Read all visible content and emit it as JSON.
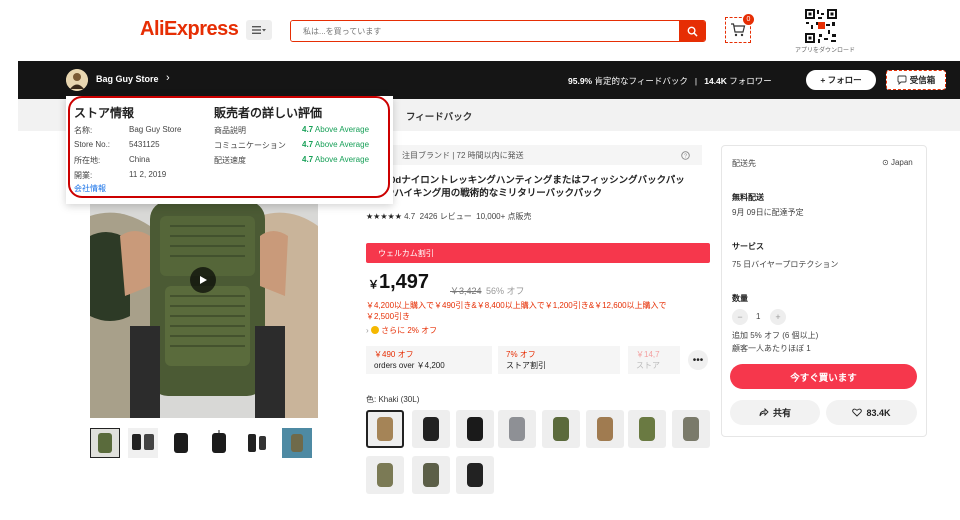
{
  "header": {
    "logo": "AliExpress",
    "menu_icon": "menu-dropdown-icon",
    "search_placeholder": "私は...を買っています",
    "search_icon": "search-icon",
    "cart_count": "0",
    "qr_caption": "アプリをダウンロード"
  },
  "store_bar": {
    "store_name": "Bag Guy Store",
    "feedback_value": "95.9%",
    "feedback_label": "肯定的なフィードバック",
    "separator": "|",
    "followers_value": "14.4K",
    "followers_label": "フォロワー",
    "follow_button": "+ フォロー",
    "message_button": "受信箱"
  },
  "nav": {
    "feedback_tab": "フィードバック"
  },
  "store_popup": {
    "left_title": "ストア情報",
    "right_title": "販売者の詳しい評価",
    "info_rows": [
      {
        "label": "名称:",
        "value": "Bag Guy Store"
      },
      {
        "label": "Store No.:",
        "value": "5431125"
      },
      {
        "label": "所在地:",
        "value": "China"
      },
      {
        "label": "開業:",
        "value": "11 2, 2019"
      }
    ],
    "ratings": [
      {
        "label": "商品説明",
        "score": "4.7",
        "text": "Above Average"
      },
      {
        "label": "コミュニケーション",
        "score": "4.7",
        "text": "Above Average"
      },
      {
        "label": "配送速度",
        "score": "4.7",
        "text": "Above Average"
      }
    ],
    "company_link": "会社情報"
  },
  "product": {
    "info_bar": "注目ブランド | 72 時間以内に発送",
    "title_line1": "L 1000dナイロントレッキングハンティングまたはフィッシングバックパッ",
    "title_line2": "ンプやハイキング用の戦術的なミリタリーバックパック",
    "stars": "★★★★★",
    "rating_value": "4.7",
    "reviews": "2426 レビュー",
    "orders": "10,000+ 点販売",
    "welcome_banner": "ウェルカム割引",
    "currency": "￥",
    "price": "1,497",
    "old_price": "￥3,424",
    "discount": "56% オフ",
    "bulk_line1": "￥4,200以上購入で￥490引き&￥8,400以上購入で￥1,200引き&￥12,600以上購入で",
    "bulk_line2": "￥2,500引き",
    "extra_discount": "さらに 2% オフ",
    "coupons": [
      {
        "top": "￥490 オフ",
        "bottom": "orders over ￥4,200"
      },
      {
        "top": "7% オフ",
        "bottom": "ストア割引"
      },
      {
        "top": "￥14,7",
        "bottom": "ストア"
      }
    ],
    "more_icon": "more-dots-icon",
    "color_label": "色: Khaki (30L)",
    "swatch_count": 11
  },
  "sidebar": {
    "ship_to_label": "配送先",
    "ship_to_value": "Japan",
    "free_ship_label": "無料配送",
    "free_ship_date": "9月 09日に配達予定",
    "service_label": "サービス",
    "service_value": "75 日バイヤープロテクション",
    "qty_label": "数量",
    "qty_value": "1",
    "qty_note1": "追加 5% オフ (6 個以上)",
    "qty_note2": "顧客一人あたりほぼ 1",
    "buy_button": "今すぐ買います",
    "share_button": "共有",
    "like_count": "83.4K"
  },
  "colors": {
    "brand_red": "#e62e04",
    "button_red": "#f6374c",
    "green": "#18a058",
    "highlight_box": "#c00"
  }
}
